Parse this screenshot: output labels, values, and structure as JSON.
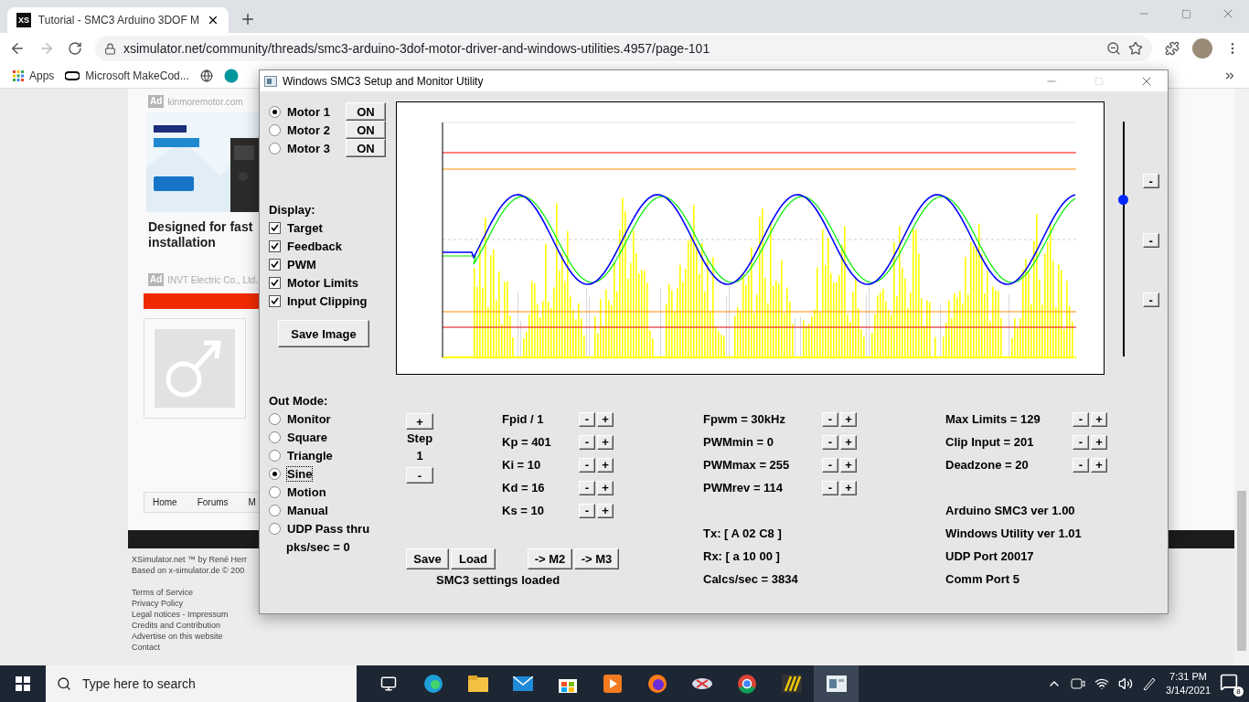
{
  "browser": {
    "favicon_text": "XS",
    "tab_title": "Tutorial - SMC3 Arduino 3DOF M",
    "url": "xsimulator.net/community/threads/smc3-arduino-3dof-motor-driver-and-windows-utilities.4957/page-101",
    "bookmarks": [
      "Apps",
      "Microsoft MakeCod..."
    ]
  },
  "page": {
    "ads": [
      {
        "badge": "Ad",
        "source": "kinmoremotor.com"
      },
      {
        "badge": "Ad",
        "source": "INVT Electric Co., Ltd."
      }
    ],
    "ad_headline": "Designed for fast installation",
    "breadcrumbs": [
      "Home",
      "Forums",
      "M"
    ],
    "footer_credits": [
      "XSimulator.net ™ by René Herr",
      "Based on x-simulator.de © 200"
    ],
    "footer_links": [
      "Terms of Service",
      "Privacy Policy",
      "Legal notices - Impressum",
      "Credits and Contribution",
      "Advertise on this website",
      "Contact"
    ]
  },
  "app": {
    "title": "Windows SMC3 Setup and Monitor Utility",
    "motors": [
      {
        "label": "Motor 1",
        "selected": true,
        "button": "ON"
      },
      {
        "label": "Motor 2",
        "selected": false,
        "button": "ON"
      },
      {
        "label": "Motor 3",
        "selected": false,
        "button": "ON"
      }
    ],
    "display_label": "Display:",
    "display_options": [
      {
        "label": "Target",
        "checked": true
      },
      {
        "label": "Feedback",
        "checked": true
      },
      {
        "label": "PWM",
        "checked": true
      },
      {
        "label": "Motor Limits",
        "checked": true
      },
      {
        "label": "Input Clipping",
        "checked": true
      }
    ],
    "save_image": "Save Image",
    "slider": {
      "level": 0.67
    },
    "side_buttons": [
      "-",
      "-",
      "-"
    ],
    "out_mode_label": "Out Mode:",
    "out_modes": [
      {
        "label": "Monitor",
        "selected": false
      },
      {
        "label": "Square",
        "selected": false
      },
      {
        "label": "Triangle",
        "selected": false
      },
      {
        "label": "Sine",
        "selected": true
      },
      {
        "label": "Motion",
        "selected": false
      },
      {
        "label": "Manual",
        "selected": false
      },
      {
        "label": "UDP Pass thru",
        "selected": false
      }
    ],
    "pks": "pks/sec = 0",
    "step": {
      "plus": "+",
      "label": "Step",
      "value": "1",
      "minus": "-"
    },
    "pid_params": [
      {
        "label": "Fpid / 1",
        "minus": "-",
        "plus": "+"
      },
      {
        "label": "Kp = 401",
        "minus": "-",
        "plus": "+"
      },
      {
        "label": "Ki = 10",
        "minus": "-",
        "plus": "+"
      },
      {
        "label": "Kd = 16",
        "minus": "-",
        "plus": "+"
      },
      {
        "label": "Ks = 10",
        "minus": "-",
        "plus": "+"
      }
    ],
    "pwm_params": [
      {
        "label": "Fpwm = 30kHz",
        "minus": "-",
        "plus": "+"
      },
      {
        "label": "PWMmin = 0",
        "minus": "-",
        "plus": "+"
      },
      {
        "label": "PWMmax = 255",
        "minus": "-",
        "plus": "+"
      },
      {
        "label": "PWMrev = 114",
        "minus": "-",
        "plus": "+"
      }
    ],
    "limit_params": [
      {
        "label": "Max Limits = 129",
        "minus": "-",
        "plus": "+"
      },
      {
        "label": "Clip Input = 201",
        "minus": "-",
        "plus": "+"
      },
      {
        "label": "Deadzone = 20",
        "minus": "-",
        "plus": "+"
      }
    ],
    "file_buttons": [
      "Save",
      "Load"
    ],
    "copy_buttons": [
      "-> M2",
      "-> M3"
    ],
    "status": "SMC3 settings loaded",
    "comm": [
      "Tx: [ A 02 C8 ]",
      "Rx: [ a 10 00 ]",
      "Calcs/sec = 3834"
    ],
    "info": [
      "Arduino SMC3 ver 1.00",
      "Windows Utility ver 1.01",
      "UDP Port 20017",
      "Comm Port 5"
    ]
  },
  "taskbar": {
    "search_placeholder": "Type here to search",
    "time": "7:31 PM",
    "date": "3/14/2021",
    "notifications": "8"
  }
}
